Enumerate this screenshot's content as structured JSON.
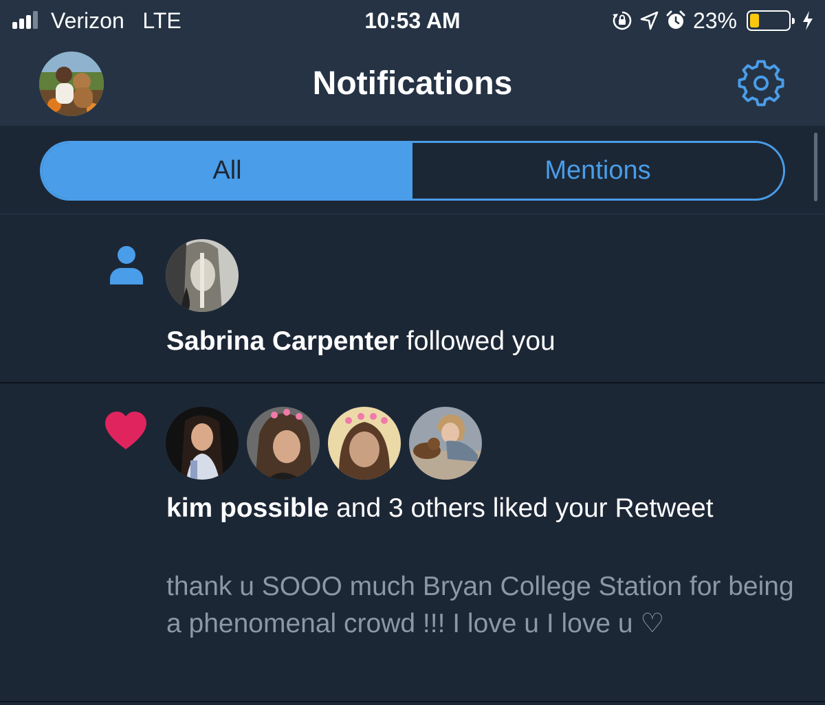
{
  "status_bar": {
    "carrier": "Verizon",
    "network": "LTE",
    "time": "10:53 AM",
    "battery_percent": "23%",
    "battery_level": 0.23,
    "icons": [
      "signal-icon",
      "rotation-lock-icon",
      "location-arrow-icon",
      "alarm-icon",
      "battery-icon",
      "charging-bolt-icon"
    ]
  },
  "nav": {
    "title": "Notifications",
    "profile_avatar": "profile-avatar",
    "settings_icon": "gear-icon"
  },
  "tabs": {
    "items": [
      {
        "label": "All",
        "selected": true
      },
      {
        "label": "Mentions",
        "selected": false
      }
    ]
  },
  "notifications": [
    {
      "type": "follow",
      "icon": "person-icon",
      "actor": "Sabrina Carpenter",
      "action": " followed you"
    },
    {
      "type": "like",
      "icon": "heart-icon",
      "actor": "kim possible",
      "action": " and 3 others liked your Retweet",
      "tweet_text": "thank u SOOO much Bryan College Station for being a phenomenal crowd !!! I love u I love u ♡"
    }
  ],
  "colors": {
    "background": "#1c2736",
    "header": "#253344",
    "accent": "#4a9de8",
    "like": "#e0245e",
    "secondary_text": "#8b98a5",
    "battery": "#f9c80e"
  }
}
